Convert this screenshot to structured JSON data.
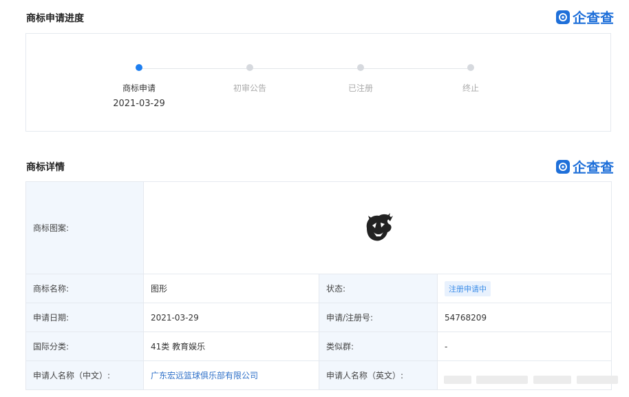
{
  "progress": {
    "title": "商标申请进度",
    "brand": "企查查",
    "steps": [
      {
        "label": "商标申请",
        "date": "2021-03-29"
      },
      {
        "label": "初审公告",
        "date": ""
      },
      {
        "label": "已注册",
        "date": ""
      },
      {
        "label": "终止",
        "date": ""
      }
    ]
  },
  "details": {
    "title": "商标详情",
    "brand": "企查查",
    "pattern_label": "商标图案:",
    "rows": [
      {
        "k1": "商标名称:",
        "v1": "图形",
        "k2": "状态:",
        "v2": "注册申请中"
      },
      {
        "k1": "申请日期:",
        "v1": "2021-03-29",
        "k2": "申请/注册号:",
        "v2": "54768209"
      },
      {
        "k1": "国际分类:",
        "v1": "41类 教育娱乐",
        "k2": "类似群:",
        "v2": "-"
      },
      {
        "k1": "申请人名称（中文）:",
        "v1": "广东宏远篮球俱乐部有限公司",
        "k2": "申请人名称（英文）:",
        "v2": ""
      }
    ]
  },
  "colors": {
    "accent": "#1e7ff0",
    "key_bg": "#f2f7fd",
    "link": "#2d6fc8"
  }
}
